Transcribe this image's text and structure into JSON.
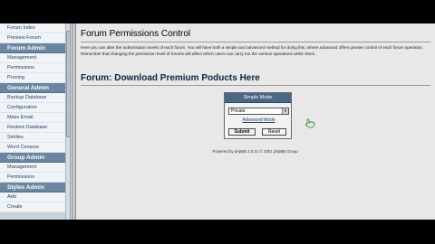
{
  "sidebar": {
    "items": [
      {
        "kind": "link",
        "label": "Forum Index"
      },
      {
        "kind": "link",
        "label": "Preview Forum"
      },
      {
        "kind": "head",
        "label": "Forum Admin"
      },
      {
        "kind": "link",
        "label": "Management"
      },
      {
        "kind": "link",
        "label": "Permissions"
      },
      {
        "kind": "link",
        "label": "Pruning"
      },
      {
        "kind": "head",
        "label": "General Admin"
      },
      {
        "kind": "link",
        "label": "Backup Database"
      },
      {
        "kind": "link",
        "label": "Configuration"
      },
      {
        "kind": "link",
        "label": "Mass Email"
      },
      {
        "kind": "link",
        "label": "Restore Database"
      },
      {
        "kind": "link",
        "label": "Smilies"
      },
      {
        "kind": "link",
        "label": "Word Censors"
      },
      {
        "kind": "head",
        "label": "Group Admin"
      },
      {
        "kind": "link",
        "label": "Management"
      },
      {
        "kind": "link",
        "label": "Permissions"
      },
      {
        "kind": "head",
        "label": "Styles Admin"
      },
      {
        "kind": "link",
        "label": "Add"
      },
      {
        "kind": "link",
        "label": "Create"
      }
    ]
  },
  "main": {
    "title": "Forum Permissions Control",
    "intro": "Here you can alter the authorisation levels of each forum. You will have both a simple and advanced method for doing this, where advanced offers greater control of each forum operation. Remember that changing the permission level of forums will affect which users can carry out the various operations within them.",
    "section_title": "Forum: Download Premium Poducts Here"
  },
  "permissions_form": {
    "header": "Simple Mode",
    "selected_level": "Private",
    "advanced_link": "Advanced Mode",
    "submit_label": "Submit",
    "reset_label": "Reset"
  },
  "footer": {
    "powered_by": "Powered by phpBB 2.0.21 © 2001 phpBB Group"
  },
  "colors": {
    "nav_header": "#6a86a0",
    "form_header": "#4a6786",
    "title_text": "#0c2242"
  }
}
